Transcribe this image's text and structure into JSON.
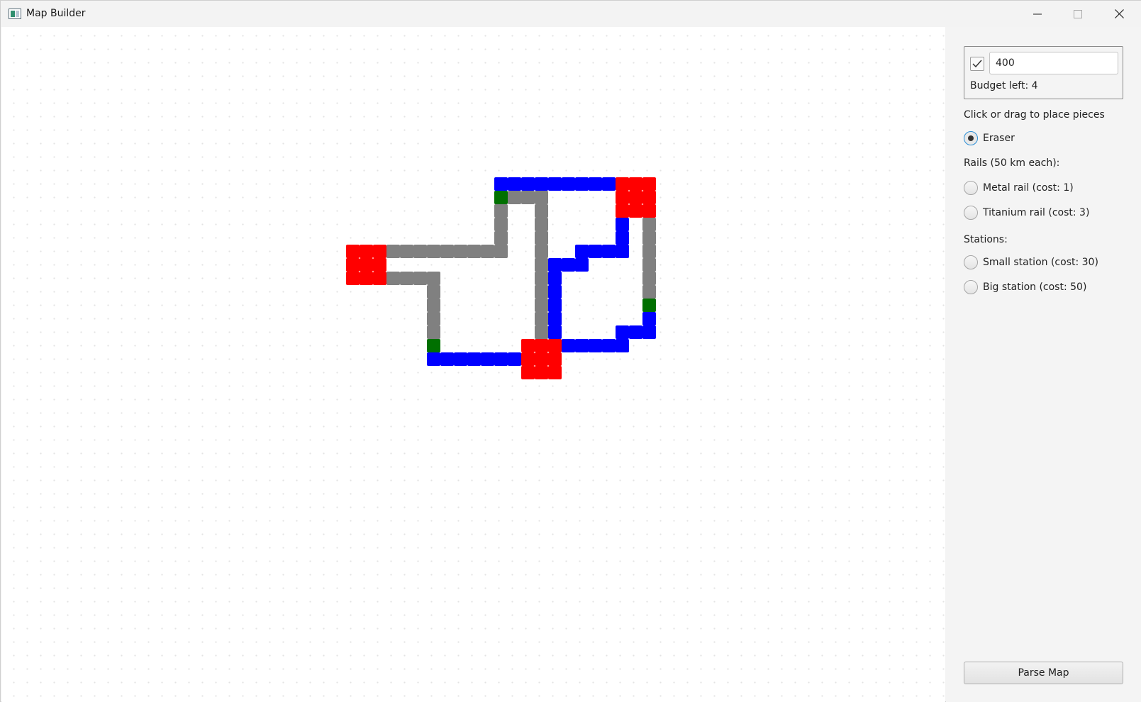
{
  "window": {
    "title": "Map Builder"
  },
  "budget": {
    "checked": true,
    "value": "400",
    "budget_left_label": "Budget left: 4"
  },
  "instructions": "Click or drag to place pieces",
  "tools": {
    "eraser": {
      "label": "Eraser",
      "selected": true
    },
    "rails_header": "Rails (50 km each):",
    "metal_rail": {
      "label": "Metal rail (cost: 1)",
      "selected": false
    },
    "titanium_rail": {
      "label": "Titanium rail (cost: 3)",
      "selected": false
    },
    "stations_header": "Stations:",
    "small_station": {
      "label": "Small station (cost: 30)",
      "selected": false
    },
    "big_station": {
      "label": "Big station (cost: 50)",
      "selected": false
    }
  },
  "parse_button": "Parse Map",
  "map": {
    "colors": {
      "metal_rail": "#808080",
      "titanium_rail": "#0000ff",
      "small_station": "#007000",
      "big_station": "#ff0000"
    },
    "grid": {
      "cols": 70,
      "rows": 51
    },
    "big_stations": [
      [
        26,
        17
      ],
      [
        46,
        12
      ],
      [
        39,
        24
      ]
    ],
    "small_stations": [
      [
        37,
        13
      ],
      [
        48,
        21
      ],
      [
        32,
        24
      ]
    ],
    "metal_rails": [
      [
        37,
        14
      ],
      [
        37,
        15
      ],
      [
        37,
        16
      ],
      [
        37,
        17
      ],
      [
        29,
        17
      ],
      [
        30,
        17
      ],
      [
        31,
        17
      ],
      [
        32,
        17
      ],
      [
        33,
        17
      ],
      [
        34,
        17
      ],
      [
        35,
        17
      ],
      [
        36,
        17
      ],
      [
        38,
        13
      ],
      [
        39,
        13
      ],
      [
        40,
        13
      ],
      [
        40,
        14
      ],
      [
        40,
        15
      ],
      [
        40,
        16
      ],
      [
        40,
        17
      ],
      [
        40,
        18
      ],
      [
        40,
        19
      ],
      [
        40,
        20
      ],
      [
        40,
        21
      ],
      [
        40,
        22
      ],
      [
        40,
        23
      ],
      [
        29,
        19
      ],
      [
        30,
        19
      ],
      [
        31,
        19
      ],
      [
        32,
        19
      ],
      [
        32,
        20
      ],
      [
        32,
        21
      ],
      [
        32,
        22
      ],
      [
        32,
        23
      ],
      [
        48,
        15
      ],
      [
        48,
        16
      ],
      [
        48,
        17
      ],
      [
        48,
        18
      ],
      [
        48,
        19
      ],
      [
        48,
        20
      ]
    ],
    "titanium_rails": [
      [
        37,
        12
      ],
      [
        38,
        12
      ],
      [
        39,
        12
      ],
      [
        40,
        12
      ],
      [
        41,
        12
      ],
      [
        42,
        12
      ],
      [
        43,
        12
      ],
      [
        44,
        12
      ],
      [
        45,
        12
      ],
      [
        46,
        15
      ],
      [
        46,
        16
      ],
      [
        46,
        17
      ],
      [
        45,
        17
      ],
      [
        44,
        17
      ],
      [
        43,
        17
      ],
      [
        43,
        18
      ],
      [
        42,
        18
      ],
      [
        41,
        18
      ],
      [
        41,
        19
      ],
      [
        41,
        20
      ],
      [
        41,
        21
      ],
      [
        41,
        22
      ],
      [
        41,
        23
      ],
      [
        42,
        24
      ],
      [
        43,
        24
      ],
      [
        44,
        24
      ],
      [
        45,
        24
      ],
      [
        46,
        24
      ],
      [
        46,
        23
      ],
      [
        47,
        23
      ],
      [
        48,
        23
      ],
      [
        48,
        22
      ],
      [
        32,
        25
      ],
      [
        33,
        25
      ],
      [
        34,
        25
      ],
      [
        35,
        25
      ],
      [
        36,
        25
      ],
      [
        37,
        25
      ],
      [
        38,
        25
      ]
    ]
  }
}
